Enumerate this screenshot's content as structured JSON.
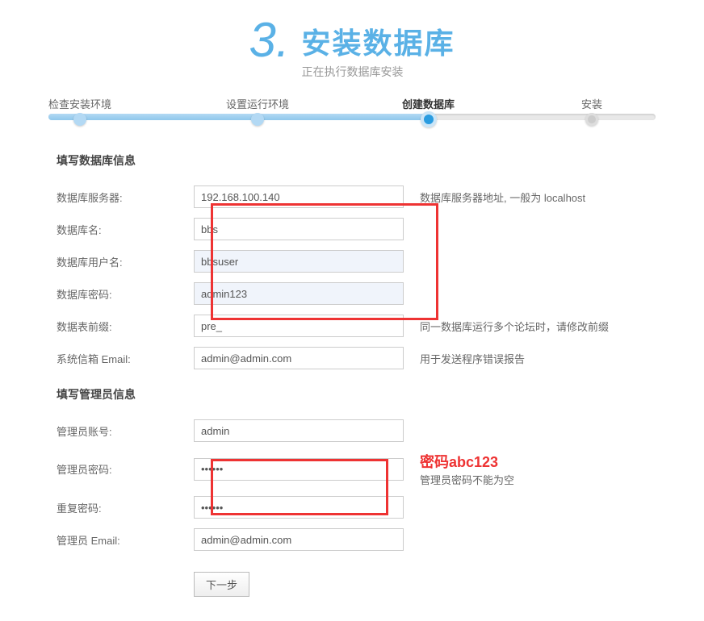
{
  "header": {
    "step_number": "3.",
    "title": "安装数据库",
    "subtitle": "正在执行数据库安装"
  },
  "steps": {
    "s1": "检查安装环境",
    "s2": "设置运行环境",
    "s3": "创建数据库",
    "s4": "安装"
  },
  "section1_title": "填写数据库信息",
  "db": {
    "server_label": "数据库服务器:",
    "server_value": "192.168.100.140",
    "server_hint": "数据库服务器地址, 一般为 localhost",
    "name_label": "数据库名:",
    "name_value": "bbs",
    "user_label": "数据库用户名:",
    "user_value": "bbsuser",
    "pwd_label": "数据库密码:",
    "pwd_value": "admin123",
    "prefix_label": "数据表前缀:",
    "prefix_value": "pre_",
    "prefix_hint": "同一数据库运行多个论坛时，请修改前缀",
    "email_label": "系统信箱 Email:",
    "email_value": "admin@admin.com",
    "email_hint": "用于发送程序错误报告"
  },
  "section2_title": "填写管理员信息",
  "admin": {
    "acc_label": "管理员账号:",
    "acc_value": "admin",
    "pwd_label": "管理员密码:",
    "pwd_value": "••••••",
    "pwd_annotation": "密码abc123",
    "pwd_hint": "管理员密码不能为空",
    "pwd2_label": "重复密码:",
    "pwd2_value": "••••••",
    "email_label": "管理员 Email:",
    "email_value": "admin@admin.com"
  },
  "next_button": "下一步"
}
